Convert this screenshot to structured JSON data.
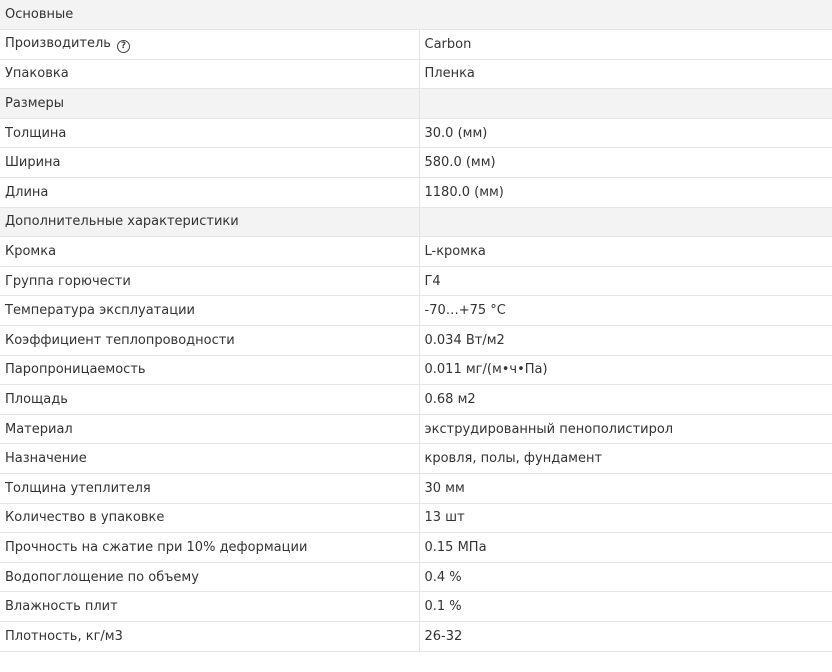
{
  "sections": [
    {
      "title": "Основные",
      "rows": [
        {
          "label": "Производитель",
          "value": "Carbon",
          "help_icon": "question-circle-icon"
        },
        {
          "label": "Упаковка",
          "value": "Пленка"
        }
      ]
    },
    {
      "title": "Размеры",
      "rows": [
        {
          "label": "Толщина",
          "value": "30.0 (мм)"
        },
        {
          "label": "Ширина",
          "value": "580.0 (мм)"
        },
        {
          "label": "Длина",
          "value": "1180.0 (мм)"
        }
      ]
    },
    {
      "title": "Дополнительные характеристики",
      "rows": [
        {
          "label": "Кромка",
          "value": "L-кромка"
        },
        {
          "label": "Группа горючести",
          "value": "Г4"
        },
        {
          "label": "Температура эксплуатации",
          "value": "-70…+75 °C"
        },
        {
          "label": "Коэффициент теплопроводности",
          "value": "0.034 Вт/м2"
        },
        {
          "label": "Паропроницаемость",
          "value": "0.011 мг/(м•ч•Па)"
        },
        {
          "label": "Площадь",
          "value": "0.68 м2"
        },
        {
          "label": "Материал",
          "value": "экструдированный пенополистирол"
        },
        {
          "label": "Назначение",
          "value": "кровля, полы, фундамент"
        },
        {
          "label": "Толщина утеплителя",
          "value": "30 мм"
        },
        {
          "label": "Количество в упаковке",
          "value": "13 шт"
        },
        {
          "label": "Прочность на сжатие при 10% деформации",
          "value": "0.15 МПа"
        },
        {
          "label": "Водопоглощение по объему",
          "value": "0.4 %"
        },
        {
          "label": "Влажность плит",
          "value": "0.1 %"
        },
        {
          "label": "Плотность, кг/м3",
          "value": "26-32"
        }
      ]
    }
  ],
  "colors": {
    "section_background": "#f3f3f3",
    "border": "#e4e4e4",
    "text": "#333333"
  }
}
